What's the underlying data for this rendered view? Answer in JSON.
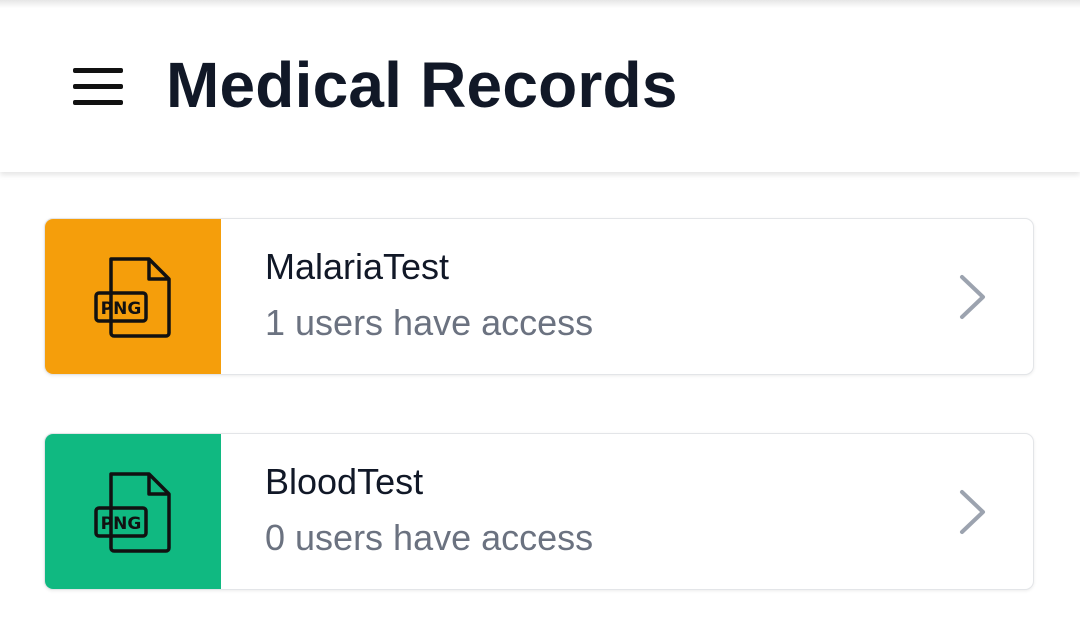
{
  "header": {
    "title": "Medical Records"
  },
  "records": [
    {
      "name": "MalariaTest",
      "access": "1 users have access",
      "file_type": "PNG",
      "color": "#f59e0b"
    },
    {
      "name": "BloodTest",
      "access": "0 users have access",
      "file_type": "PNG",
      "color": "#10b981"
    }
  ],
  "icons": {
    "menu": "hamburger-menu-icon",
    "file": "png-file-icon",
    "chevron": "chevron-right-icon"
  },
  "colors": {
    "title": "#111827",
    "subtitle": "#6b7280",
    "chevron": "#9ca3af"
  }
}
